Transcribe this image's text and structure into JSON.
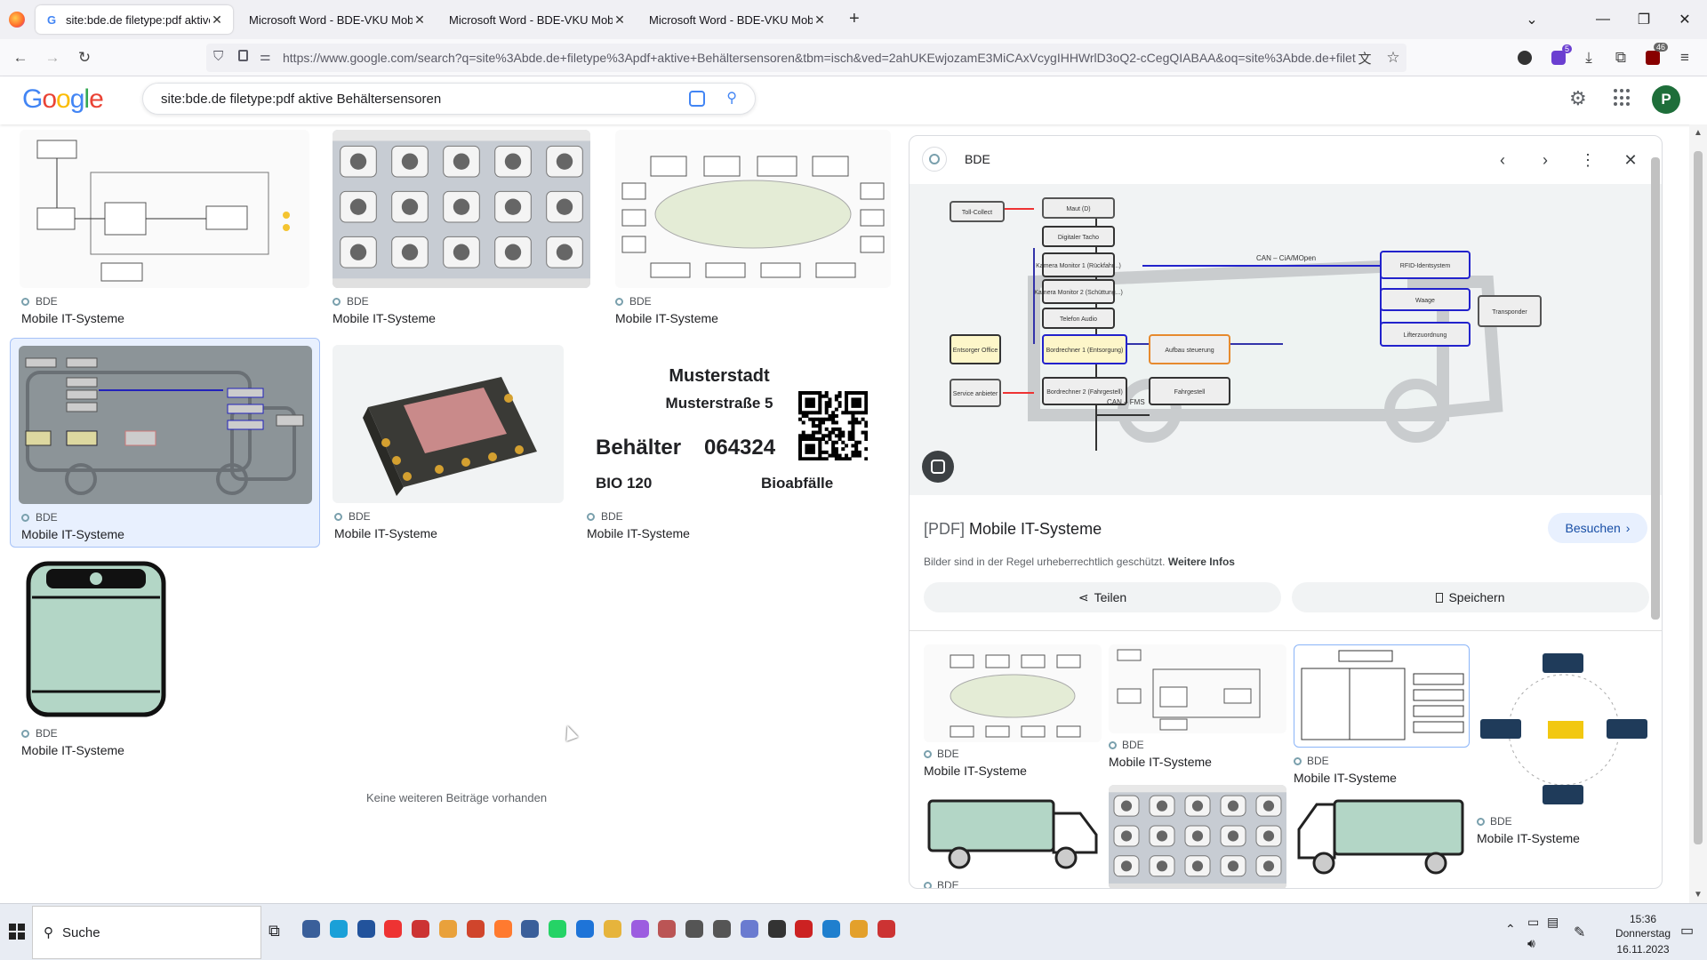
{
  "browser": {
    "tabs": [
      {
        "title": "site:bde.de filetype:pdf aktive B",
        "active": true
      },
      {
        "title": "Microsoft Word - BDE-VKU Mobile-",
        "active": false
      },
      {
        "title": "Microsoft Word - BDE-VKU Mobile-",
        "active": false
      },
      {
        "title": "Microsoft Word - BDE-VKU Mobile-",
        "active": false
      }
    ],
    "url": "https://www.google.com/search?q=site%3Abde.de+filetype%3Apdf+aktive+Behältersensoren&tbm=isch&ved=2ahUKEwjozamE3MiCAxVcygIHHWrlD3oQ2-cCegQIABAA&oq=site%3Abde.de+filet",
    "extension_badges": {
      "notifications": "5",
      "ublock": "46"
    }
  },
  "google": {
    "logo": "Google",
    "query": "site:bde.de filetype:pdf aktive Behältersensoren",
    "avatar_letter": "P"
  },
  "results": [
    {
      "source": "BDE",
      "caption": "Mobile IT-Systeme",
      "kind": "diagram-org"
    },
    {
      "source": "BDE",
      "caption": "Mobile IT-Systeme",
      "kind": "menu-grid"
    },
    {
      "source": "BDE",
      "caption": "Mobile IT-Systeme",
      "kind": "cloud-diagram"
    },
    {
      "source": "BDE",
      "caption": "Mobile IT-Systeme",
      "kind": "truck-diagram",
      "selected": true
    },
    {
      "source": "BDE",
      "caption": "Mobile IT-Systeme",
      "kind": "device"
    },
    {
      "source": "BDE",
      "caption": "Mobile IT-Systeme",
      "kind": "label"
    },
    {
      "source": "BDE",
      "caption": "Mobile IT-Systeme",
      "kind": "bin"
    }
  ],
  "bin_label": {
    "city": "Musterstadt",
    "street": "Musterstraße 5",
    "container": "Behälter",
    "number": "064324",
    "type": "BIO 120",
    "waste": "Bioabfälle"
  },
  "no_more": "Keine weiteren Beiträge vorhanden",
  "panel": {
    "source": "BDE",
    "title_prefix": "[PDF]",
    "title": "Mobile IT-Systeme",
    "visit": "Besuchen",
    "copyright": "Bilder sind in der Regel urheberrechtlich geschützt.",
    "more_info": "Weitere Infos",
    "share": "Teilen",
    "save": "Speichern",
    "diagram": {
      "boxes": [
        "Toll-Collect",
        "Maut (D)",
        "Digitaler Tacho",
        "Kamera Monitor 1 (Rückfahr...)",
        "Kamera Monitor 2 (Schüttung...)",
        "Telefon Audio",
        "Entsorger Office",
        "Bordrechner 1 (Entsorgung)",
        "Aufbau steuerung",
        "Service anbieter",
        "Bordrechner 2 (Fahrgestell)",
        "Fahrgestell",
        "RFID-Identsystem",
        "Waage",
        "Lifterzuordnung",
        "Transponder"
      ],
      "bus_labels": [
        "CAN – CiA/MOpen",
        "CAN – FMS"
      ]
    },
    "related": [
      {
        "source": "BDE",
        "caption": "Mobile IT-Systeme"
      },
      {
        "source": "BDE",
        "caption": "Mobile IT-Systeme"
      },
      {
        "source": "BDE",
        "caption": "Mobile IT-Systeme"
      },
      {
        "source": "BDE",
        "caption": "Mobile IT-Systeme"
      },
      {
        "source": "BDE",
        "caption": ""
      }
    ]
  },
  "taskbar": {
    "search": "Suche",
    "time": "15:36",
    "day": "Donnerstag",
    "date": "16.11.2023"
  }
}
